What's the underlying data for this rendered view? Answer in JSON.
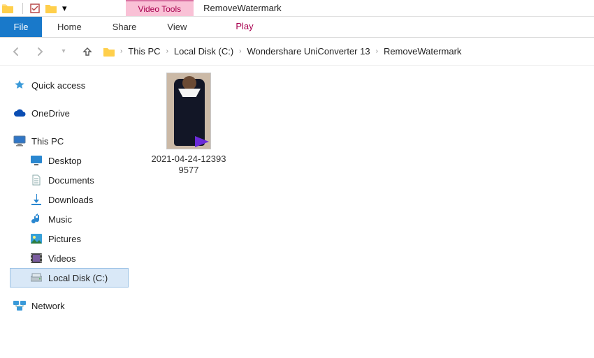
{
  "titlebar": {
    "tool_tab": "Video Tools",
    "window_title": "RemoveWatermark"
  },
  "ribbon": {
    "file": "File",
    "home": "Home",
    "share": "Share",
    "view": "View",
    "play": "Play"
  },
  "breadcrumb": {
    "items": [
      "This PC",
      "Local Disk (C:)",
      "Wondershare UniConverter 13",
      "RemoveWatermark"
    ]
  },
  "sidebar": {
    "quick_access": "Quick access",
    "onedrive": "OneDrive",
    "this_pc": "This PC",
    "children": {
      "desktop": "Desktop",
      "documents": "Documents",
      "downloads": "Downloads",
      "music": "Music",
      "pictures": "Pictures",
      "videos": "Videos",
      "local_disk": "Local Disk (C:)"
    },
    "network": "Network"
  },
  "content": {
    "files": [
      {
        "name_line1": "2021-04-24-12393",
        "name_line2": "9577"
      }
    ]
  }
}
